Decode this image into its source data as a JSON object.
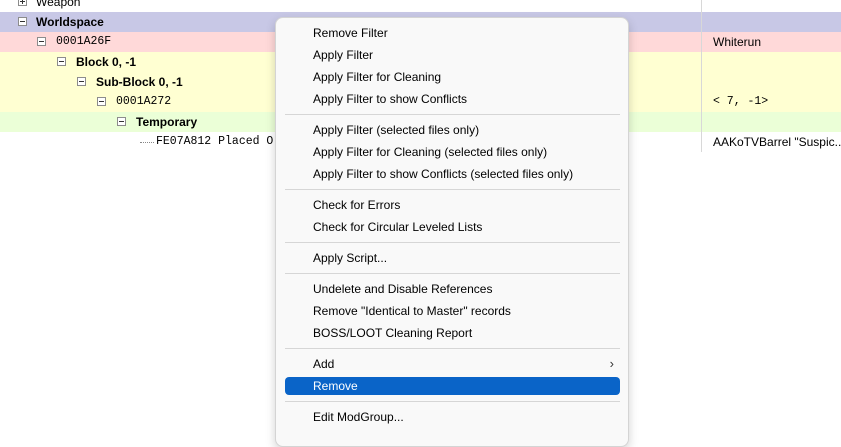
{
  "tree": {
    "rows": [
      {
        "label": "Weapon",
        "right": ""
      },
      {
        "label": "Worldspace",
        "right": ""
      },
      {
        "label": "0001A26F",
        "right": "Whiterun"
      },
      {
        "label": "Block 0, -1",
        "right": ""
      },
      {
        "label": "Sub-Block 0, -1",
        "right": ""
      },
      {
        "label": "0001A272",
        "right": "< 7, -1>"
      },
      {
        "label": "Temporary",
        "right": ""
      },
      {
        "label": "FE07A812  Placed O",
        "right": "AAKoTVBarrel \"Suspic..."
      }
    ],
    "colors": {
      "worldspace": "#c8c8e6",
      "pink": "#ffd9d9",
      "yellow": "#ffffd2",
      "green": "#ebffd7"
    }
  },
  "context_menu": {
    "items": [
      "Remove Filter",
      "Apply Filter",
      "Apply Filter for Cleaning",
      "Apply Filter to show Conflicts",
      "Apply Filter (selected files only)",
      "Apply Filter for Cleaning (selected files only)",
      "Apply Filter to show Conflicts (selected files only)",
      "Check for Errors",
      "Check for Circular Leveled Lists",
      "Apply Script...",
      "Undelete and Disable References",
      "Remove \"Identical to Master\" records",
      "BOSS/LOOT Cleaning Report",
      "Add",
      "Remove",
      "Edit ModGroup..."
    ],
    "submenu_arrow": "›",
    "active_item": "Remove",
    "accent_color": "#0a64c8"
  }
}
